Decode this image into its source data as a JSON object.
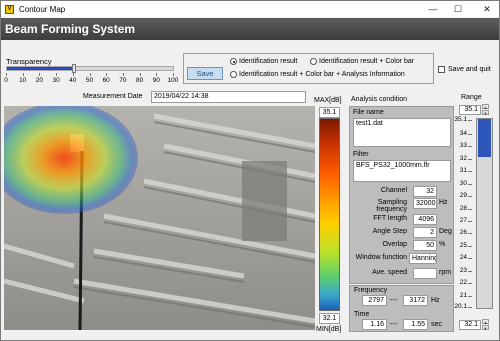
{
  "window": {
    "title": "Contour Map",
    "icon_label": "V",
    "minimize": "—",
    "maximize": "☐",
    "close": "✕"
  },
  "app": {
    "title": "Beam Forming System"
  },
  "transparency": {
    "label": "Transparency",
    "value": 40,
    "ticks": [
      "0",
      "10",
      "20",
      "30",
      "40",
      "50",
      "60",
      "70",
      "80",
      "90",
      "100"
    ]
  },
  "save_panel": {
    "save_label": "Save",
    "options": [
      "Identification result",
      "Identification result + Color bar",
      "Identification result + Color bar + Analysis Information"
    ],
    "selected": 0,
    "save_quit_label": "Save and quit"
  },
  "measurement": {
    "label": "Measurement Date",
    "value": "2019/04/22 14:38"
  },
  "colorbar": {
    "max_label": "MAX[dB]",
    "max_value": "35.1",
    "min_value": "32.1",
    "min_label": "MIN[dB]"
  },
  "analysis": {
    "title": "Analysis condition",
    "file_name_label": "File name",
    "file_name": "test1.dat",
    "filter_label": "Filter",
    "filter": "BFS_PS32_1000mm.flr",
    "rows": [
      {
        "label": "Channel",
        "value": "32",
        "unit": ""
      },
      {
        "label": "Sampling frequency",
        "value": "32000",
        "unit": "Hz"
      },
      {
        "label": "FFT length",
        "value": "4096",
        "unit": ""
      },
      {
        "label": "Angle Step",
        "value": "2",
        "unit": "Deg"
      },
      {
        "label": "Overlap",
        "value": "50",
        "unit": "%"
      },
      {
        "label": "Window function",
        "value": "Hanning",
        "unit": ""
      },
      {
        "label": "Ave. speed",
        "value": "",
        "unit": "rpm"
      }
    ],
    "frequency_label": "Frequency",
    "freq_from": "2797",
    "freq_sep": "---",
    "freq_to": "3172",
    "freq_unit": "Hz",
    "time_label": "Time",
    "time_from": "1.16",
    "time_sep": "---",
    "time_to": "1.55",
    "time_unit": "sec"
  },
  "range": {
    "label": "Range",
    "top_value": "35.1",
    "bottom_value": "32.1",
    "scale_top": "35.1",
    "ticks": [
      "34",
      "33",
      "32",
      "31",
      "30",
      "29",
      "28",
      "27",
      "26",
      "25",
      "24",
      "23",
      "22",
      "21"
    ],
    "scale_bottom": "20.1",
    "upper": 35.1,
    "lower": 32.1,
    "min": 20.1,
    "max": 35.1
  }
}
